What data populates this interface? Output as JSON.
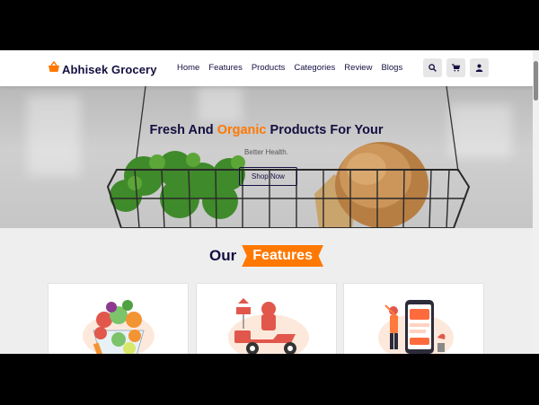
{
  "header": {
    "brand": "Abhisek Grocery",
    "nav": [
      "Home",
      "Features",
      "Products",
      "Categories",
      "Review",
      "Blogs"
    ],
    "icons": [
      "search-icon",
      "cart-icon",
      "user-icon"
    ]
  },
  "hero": {
    "title_pre": "Fresh And ",
    "title_accent": "Organic",
    "title_post": " Products For Your",
    "subtitle": "Better Health.",
    "button": "Shop Now"
  },
  "features": {
    "heading_plain": "Our",
    "heading_tag": "Features"
  },
  "colors": {
    "brand_dark": "#130f40",
    "accent": "#ff7800",
    "section_bg": "#eeeeee"
  }
}
